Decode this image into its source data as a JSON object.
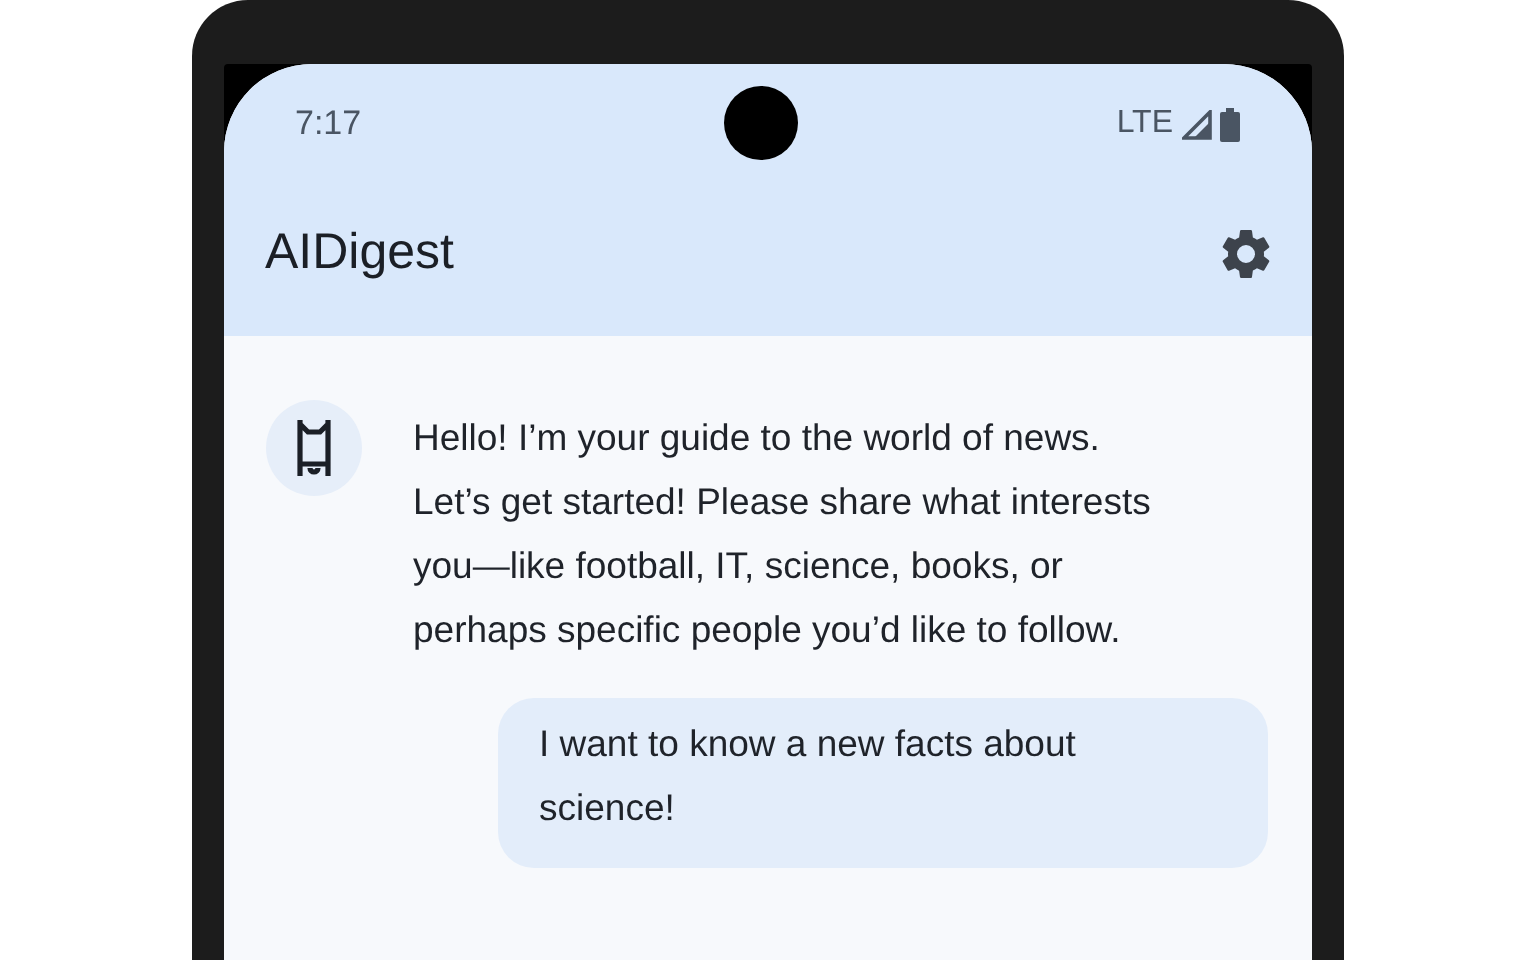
{
  "status_bar": {
    "time": "7:17",
    "network": "LTE"
  },
  "app_bar": {
    "title": "AIDigest"
  },
  "messages": [
    {
      "kind": "bot",
      "text": "Hello! I’m your guide to the world of news. Let’s get started! Please share what interests you—like football, IT, science, books, or perhaps specific people you’d like to follow."
    },
    {
      "kind": "user",
      "text": "I want to know a new facts about science!"
    }
  ]
}
